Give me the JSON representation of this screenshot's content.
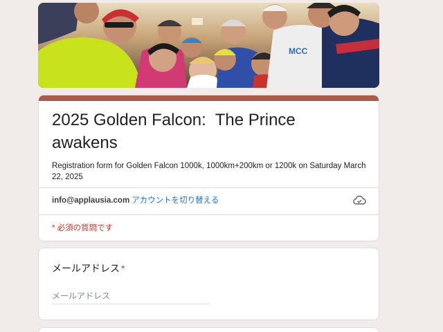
{
  "form": {
    "title": "2025 Golden Falcon:  The Prince awakens",
    "description": "Registration form for Golden Falcon 1000k, 1000km+200km or 1200k on Saturday March 22, 2025",
    "accent_color": "#a95a4c"
  },
  "account": {
    "email": "info@applausia.com",
    "switch_label": "アカウントを切り替える",
    "cloud_icon": "cloud-save-icon"
  },
  "required_note": "* 必須の質問です",
  "questions": [
    {
      "label": "メールアドレス",
      "required_mark": "*",
      "placeholder": "メールアドレス",
      "value": ""
    }
  ],
  "banner": {
    "jersey_text": "MCC",
    "description": "group of cyclists photo"
  }
}
